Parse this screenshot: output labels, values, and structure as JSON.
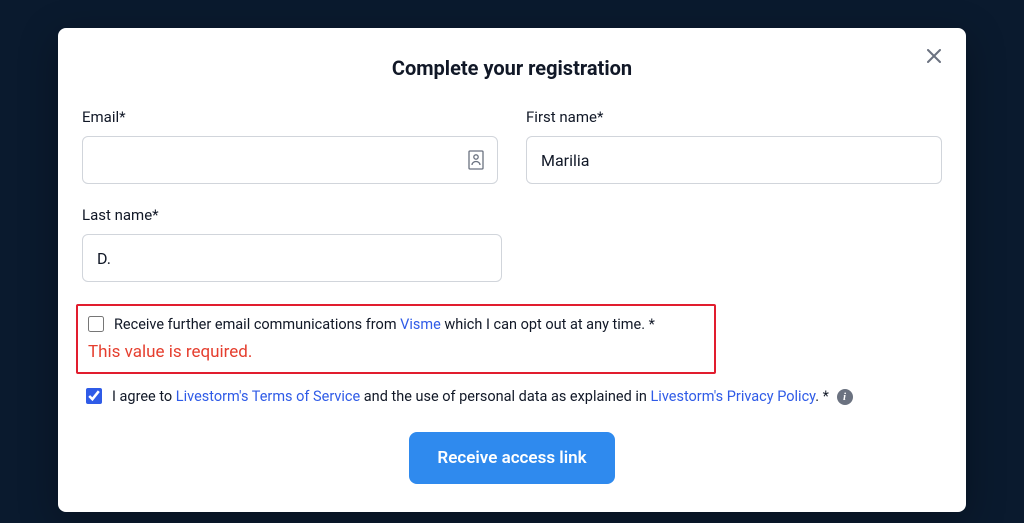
{
  "modal": {
    "title": "Complete your registration",
    "close_label": "Close"
  },
  "fields": {
    "email": {
      "label": "Email*",
      "value": ""
    },
    "first_name": {
      "label": "First name*",
      "value": "Marilia"
    },
    "last_name": {
      "label": "Last name*",
      "value": "D."
    }
  },
  "consent": {
    "marketing": {
      "checked": false,
      "text_before": "Receive further email communications from ",
      "link_text": "Visme",
      "text_after": " which I can opt out at any time. *",
      "error": "This value is required."
    },
    "terms": {
      "checked": true,
      "text_before": "I agree to ",
      "tos_link": "Livestorm's Terms of Service",
      "text_mid": " and the use of personal data as explained in ",
      "privacy_link": "Livestorm's Privacy Policy",
      "text_after": ". *"
    }
  },
  "submit": {
    "label": "Receive access link"
  }
}
